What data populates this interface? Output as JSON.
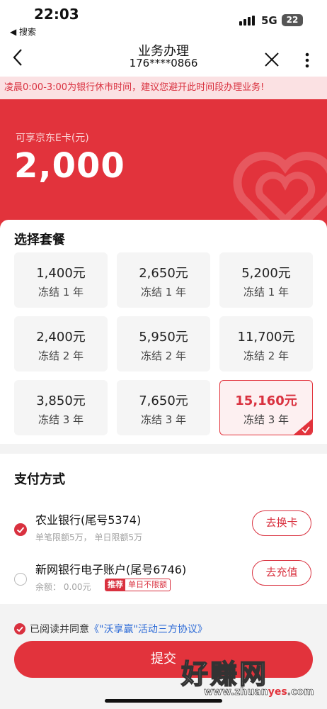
{
  "status_bar": {
    "time": "22:03",
    "back_app": "◀ 搜索",
    "network": "5G",
    "battery": "22"
  },
  "navbar": {
    "title": "业务办理",
    "subtitle": "176****0866"
  },
  "notice": "凌晨0:00-3:00为银行休市时间，建议您避开此时间段办理业务!",
  "hero": {
    "label": "可享京东E卡(元)",
    "amount": "2,000"
  },
  "plans": {
    "heading": "选择套餐",
    "items": [
      {
        "price": "1,400元",
        "term": "冻结 1 年",
        "selected": false
      },
      {
        "price": "2,650元",
        "term": "冻结 1 年",
        "selected": false
      },
      {
        "price": "5,200元",
        "term": "冻结 1 年",
        "selected": false
      },
      {
        "price": "2,400元",
        "term": "冻结 2 年",
        "selected": false
      },
      {
        "price": "5,950元",
        "term": "冻结 2 年",
        "selected": false
      },
      {
        "price": "11,700元",
        "term": "冻结 2 年",
        "selected": false
      },
      {
        "price": "3,850元",
        "term": "冻结 3 年",
        "selected": false
      },
      {
        "price": "7,650元",
        "term": "冻结 3 年",
        "selected": false
      },
      {
        "price": "15,160元",
        "term": "冻结 3 年",
        "selected": true
      }
    ]
  },
  "payment": {
    "heading": "支付方式",
    "methods": [
      {
        "name": "农业银行(尾号5374)",
        "limit": "单笔限额5万， 单日限额5万",
        "action": "去换卡",
        "selected": true
      },
      {
        "name": "新网银行电子账户(尾号6746)",
        "limit": "余额： 0.00元",
        "tag_primary": "推荐",
        "tag_secondary": "单日不限额",
        "action": "去充值",
        "selected": false
      }
    ]
  },
  "agreement": {
    "prefix": "已阅读并同意",
    "link": "《\"沃享赢\"活动三方协议》",
    "checked": true
  },
  "submit_label": "提交",
  "watermark": {
    "logo": "好赚网",
    "url_prefix": "www.zhuan",
    "url_highlight": "yes",
    "url_suffix": ".com"
  },
  "colors": {
    "brand_red": "#e2333c",
    "notice_bg": "#fbe1e3",
    "link_blue": "#2d6bd7"
  },
  "icons": [
    "back-chevron-icon",
    "close-icon",
    "more-vertical-icon",
    "heart-knot-icon",
    "check-corner-icon",
    "radio-checked-icon"
  ]
}
